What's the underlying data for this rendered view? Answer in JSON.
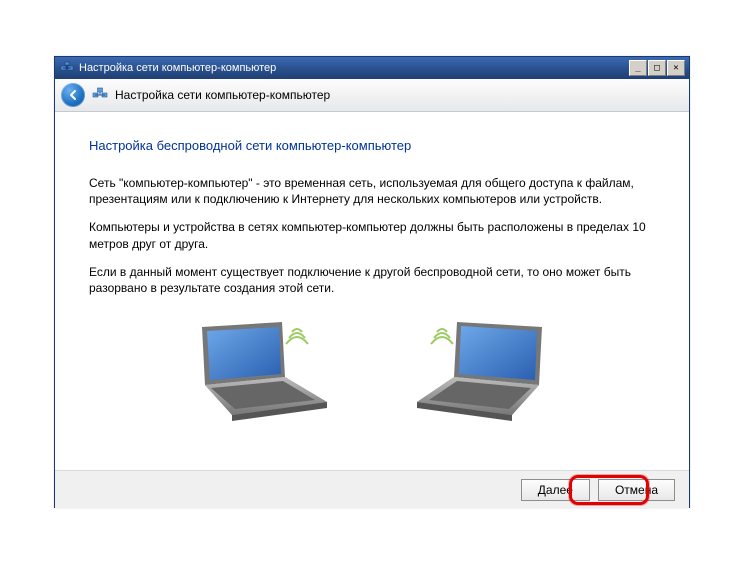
{
  "window": {
    "title": "Настройка сети компьютер-компьютер"
  },
  "header": {
    "title": "Настройка сети компьютер-компьютер"
  },
  "content": {
    "heading": "Настройка беспроводной сети компьютер-компьютер",
    "para1": "Сеть \"компьютер-компьютер\" - это временная сеть, используемая для общего доступа к файлам, презентациям или к подключению к Интернету для нескольких компьютеров или устройств.",
    "para2": "Компьютеры и устройства в сетях компьютер-компьютер должны быть расположены в пределах 10 метров друг от друга.",
    "para3": "Если в данный момент существует подключение к другой беспроводной сети, то оно может быть разорвано в результате создания этой сети."
  },
  "footer": {
    "next": "Далее",
    "cancel": "Отмена"
  }
}
